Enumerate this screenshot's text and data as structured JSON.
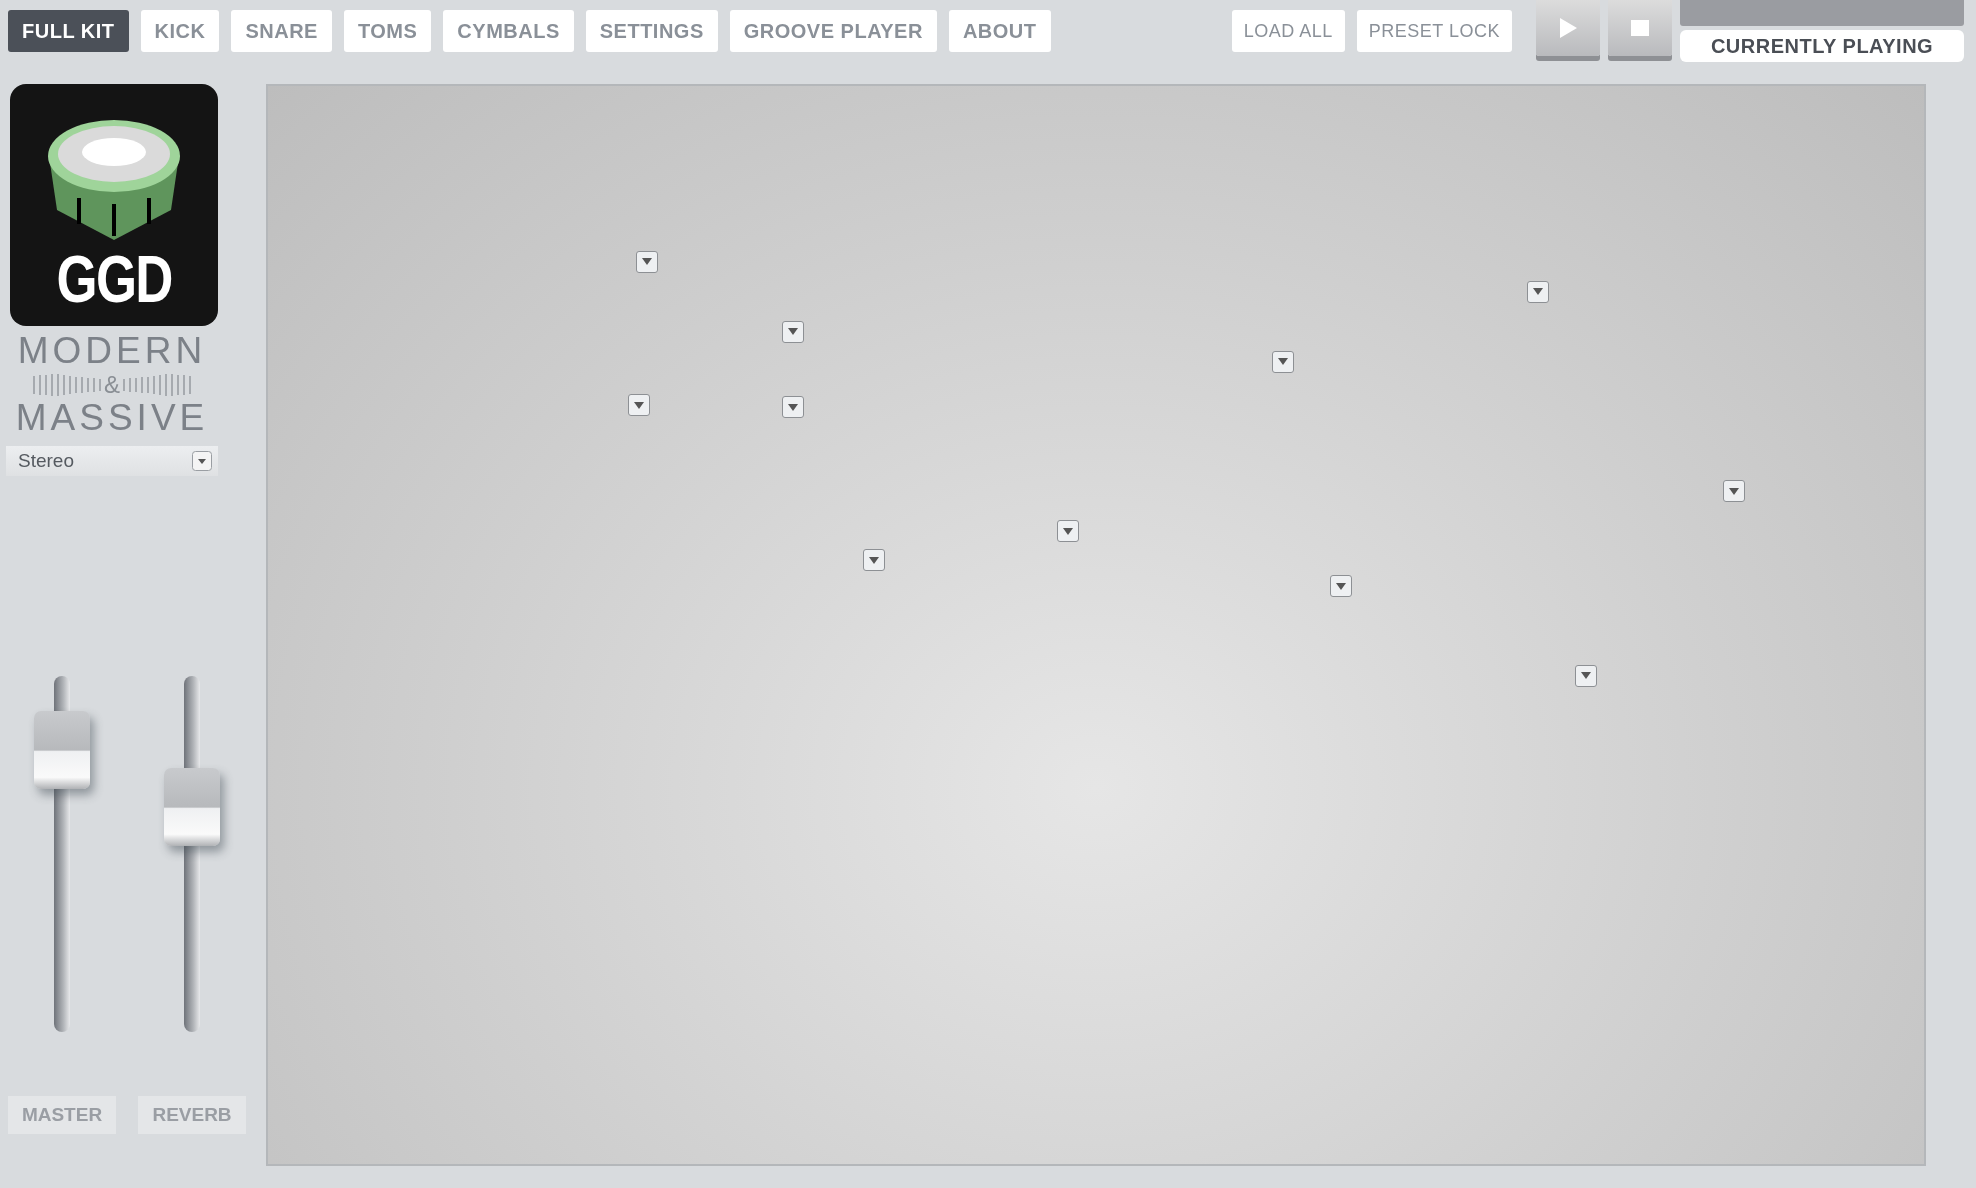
{
  "tabs": [
    {
      "label": "FULL KIT",
      "selected": true
    },
    {
      "label": "KICK",
      "selected": false
    },
    {
      "label": "SNARE",
      "selected": false
    },
    {
      "label": "TOMS",
      "selected": false
    },
    {
      "label": "CYMBALS",
      "selected": false
    },
    {
      "label": "SETTINGS",
      "selected": false
    },
    {
      "label": "GROOVE PLAYER",
      "selected": false
    },
    {
      "label": "ABOUT",
      "selected": false
    }
  ],
  "actions": [
    "LOAD ALL",
    "PRESET LOCK"
  ],
  "transport": {
    "now_playing_label": "CURRENTLY PLAYING"
  },
  "brand": {
    "logo_text": "GGD",
    "title_line_1": "MODERN",
    "ampersand": "&",
    "title_line_2": "MASSIVE"
  },
  "output_mode": {
    "value": "Stereo"
  },
  "faders": [
    {
      "label": "MASTER",
      "level": 0.79
    },
    {
      "label": "REVERB",
      "level": 0.63
    }
  ]
}
